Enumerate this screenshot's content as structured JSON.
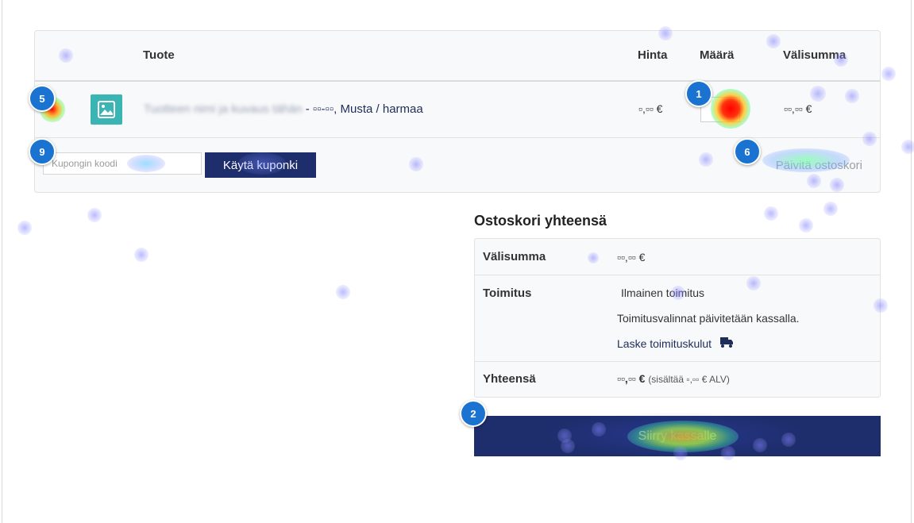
{
  "table": {
    "headers": {
      "product": "Tuote",
      "price": "Hinta",
      "quantity": "Määrä",
      "subtotal": "Välisumma"
    },
    "row": {
      "product_blurred": "Tuotteen nimi ja kuvaus tähän",
      "product_suffix": "- ▫▫-▫▫, Musta / harmaa",
      "price": "▫,▫▫ €",
      "quantity": "",
      "subtotal": "▫▫,▫▫ €"
    },
    "coupon": {
      "placeholder": "Kupongin koodi",
      "button": "Käytä kuponki"
    },
    "update_cart": "Päivitä ostoskori"
  },
  "totals": {
    "title": "Ostoskori yhteensä",
    "subtotal_label": "Välisumma",
    "subtotal_value": "▫▫,▫▫ €",
    "shipping_label": "Toimitus",
    "shipping_free": "Ilmainen toimitus",
    "shipping_note": "Toimitusvalinnat päivitetään kassalla.",
    "shipping_calc": "Laske toimituskulut",
    "total_label": "Yhteensä",
    "total_value": "▫▫,▫▫ €",
    "total_tax_note": "(sisältää ▫,▫▫ € ALV)",
    "checkout_button": "Siirry kassalle"
  },
  "badges": {
    "b1": "1",
    "b2": "2",
    "b5": "5",
    "b6": "6",
    "b9": "9"
  },
  "colors": {
    "primary": "#1e2d6b",
    "badge": "#1a73d1",
    "thumbnail": "#3ab5b3"
  },
  "icons": {
    "thumbnail": "image-icon",
    "shipping": "truck-icon"
  }
}
